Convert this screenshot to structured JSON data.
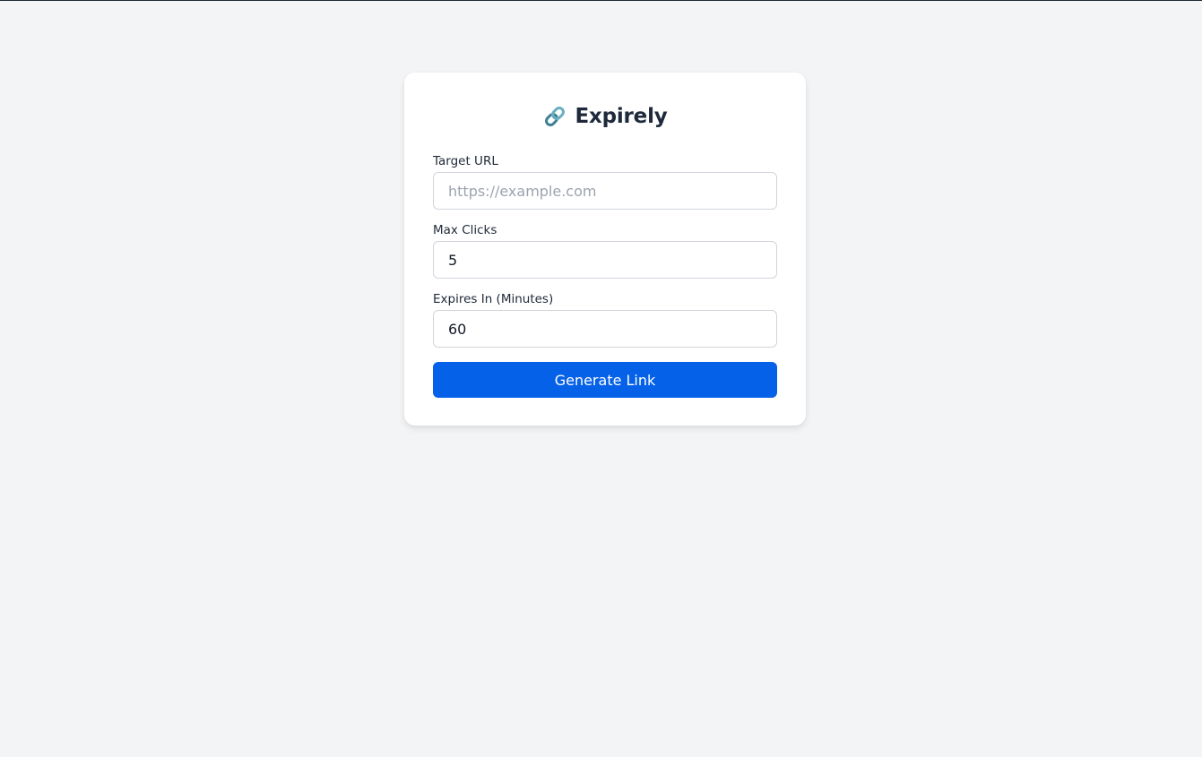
{
  "app": {
    "title": "Expirely",
    "icon": "link-icon"
  },
  "form": {
    "target_url": {
      "label": "Target URL",
      "placeholder": "https://example.com",
      "value": ""
    },
    "max_clicks": {
      "label": "Max Clicks",
      "value": "5"
    },
    "expires_in": {
      "label": "Expires In (Minutes)",
      "value": "60"
    },
    "submit_label": "Generate Link"
  },
  "colors": {
    "background": "#f3f4f6",
    "card": "#ffffff",
    "primary": "#0561e8",
    "text": "#1e293b"
  }
}
